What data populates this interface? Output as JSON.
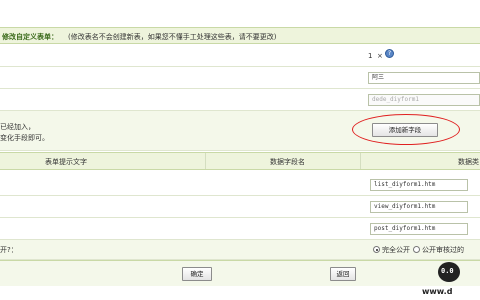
{
  "title_bar": {
    "title": "修改自定义表单：",
    "note": "(修改表名不会创建新表，如果您不懂手工处理这些表，请不要更改)"
  },
  "rows": {
    "id_value": "1",
    "id_suffix": "×",
    "name_value": "阿三",
    "table_value": "dede_diyform1",
    "desc_line1": "已经加入，",
    "desc_line2": "变化手段即可。",
    "add_field_label": "添加新字段"
  },
  "table_header": {
    "col1": "表单提示文字",
    "col2": "数据字段名",
    "col3": "数据类"
  },
  "templates": {
    "list": "list_diyform1.htm",
    "view": "view_diyform1.htm",
    "post": "post_diyform1.htm"
  },
  "public": {
    "question": "开?：",
    "opt1": "完全公开",
    "opt2": "公开审核过的"
  },
  "footer": {
    "confirm": "确定",
    "back": "返回"
  },
  "watermark": {
    "face": "0.0",
    "text": "www.d"
  }
}
